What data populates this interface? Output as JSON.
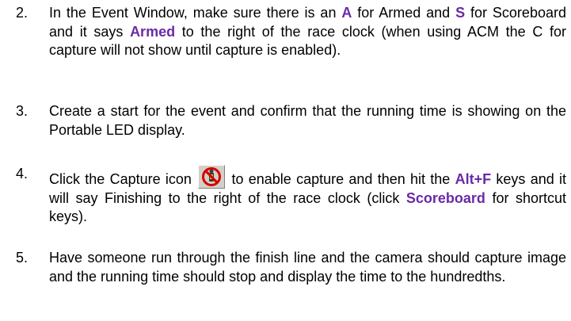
{
  "steps": [
    {
      "number": "2.",
      "segments": [
        {
          "text": "In the Event Window, make sure there is an ",
          "hl": false
        },
        {
          "text": "A",
          "hl": true
        },
        {
          "text": " for Armed and ",
          "hl": false
        },
        {
          "text": "S",
          "hl": true
        },
        {
          "text": " for Scoreboard and it says ",
          "hl": false
        },
        {
          "text": "Armed",
          "hl": true
        },
        {
          "text": " to the right of the race clock (when using ACM the C for capture will not show until capture is enabled).",
          "hl": false
        }
      ]
    },
    {
      "number": "3.",
      "segments": [
        {
          "text": "Create a start for the event and confirm that the running time is showing on the Portable LED display.",
          "hl": false
        }
      ]
    },
    {
      "number": "4.",
      "segments": [
        {
          "text": "Click the Capture icon ",
          "hl": false
        },
        {
          "icon": "capture-disabled-icon"
        },
        {
          "text": " to enable capture and then hit the ",
          "hl": false
        },
        {
          "text": "Alt+F",
          "hl": true
        },
        {
          "text": " keys and it will say Finishing to the right of the race clock (click ",
          "hl": false
        },
        {
          "text": "Scoreboard",
          "hl": true
        },
        {
          "text": " for shortcut keys).",
          "hl": false
        }
      ]
    },
    {
      "number": "5.",
      "segments": [
        {
          "text": "Have someone run through the finish line and the camera should capture image and the running time should stop and display the time to the hundredths.",
          "hl": false
        }
      ]
    }
  ],
  "colors": {
    "highlight": "#6a2aa7",
    "icon_prohibit": "#d40000"
  }
}
